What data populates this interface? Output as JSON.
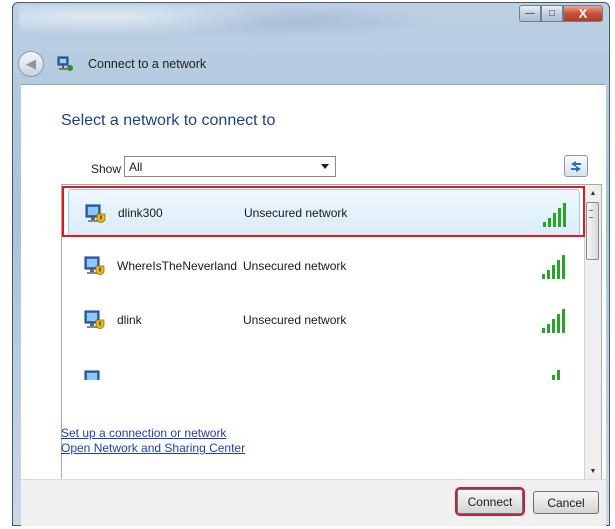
{
  "window": {
    "title_bar_buttons": {
      "minimize": "—",
      "maximize": "□",
      "close": "X"
    }
  },
  "nav": {
    "title": "Connect to a network",
    "back_icon": "back-arrow-icon",
    "app_icon": "network-icon"
  },
  "main": {
    "heading": "Select a network to connect to",
    "show_label": "Show",
    "show_value": "All",
    "refresh_icon": "refresh-icon",
    "networks": [
      {
        "ssid": "dlink300",
        "security": "Unsecured network",
        "signal": "strong",
        "selected": true
      },
      {
        "ssid": "WhereIsTheNeverland",
        "security": "Unsecured network",
        "signal": "strong",
        "selected": false
      },
      {
        "ssid": "dlink",
        "security": "Unsecured network",
        "signal": "strong",
        "selected": false
      },
      {
        "ssid": "",
        "security": "",
        "signal": "partial",
        "selected": false
      }
    ]
  },
  "links": {
    "setup": "Set up a connection or network",
    "sharing_center": "Open Network and Sharing Center"
  },
  "footer": {
    "connect_label": "Connect",
    "cancel_label": "Cancel"
  },
  "colors": {
    "heading": "#1e3f8c",
    "link": "#1d3fb6",
    "annotation_red": "#e0191f",
    "selection": "#d9ecf9",
    "signal_green": "#29a329"
  }
}
